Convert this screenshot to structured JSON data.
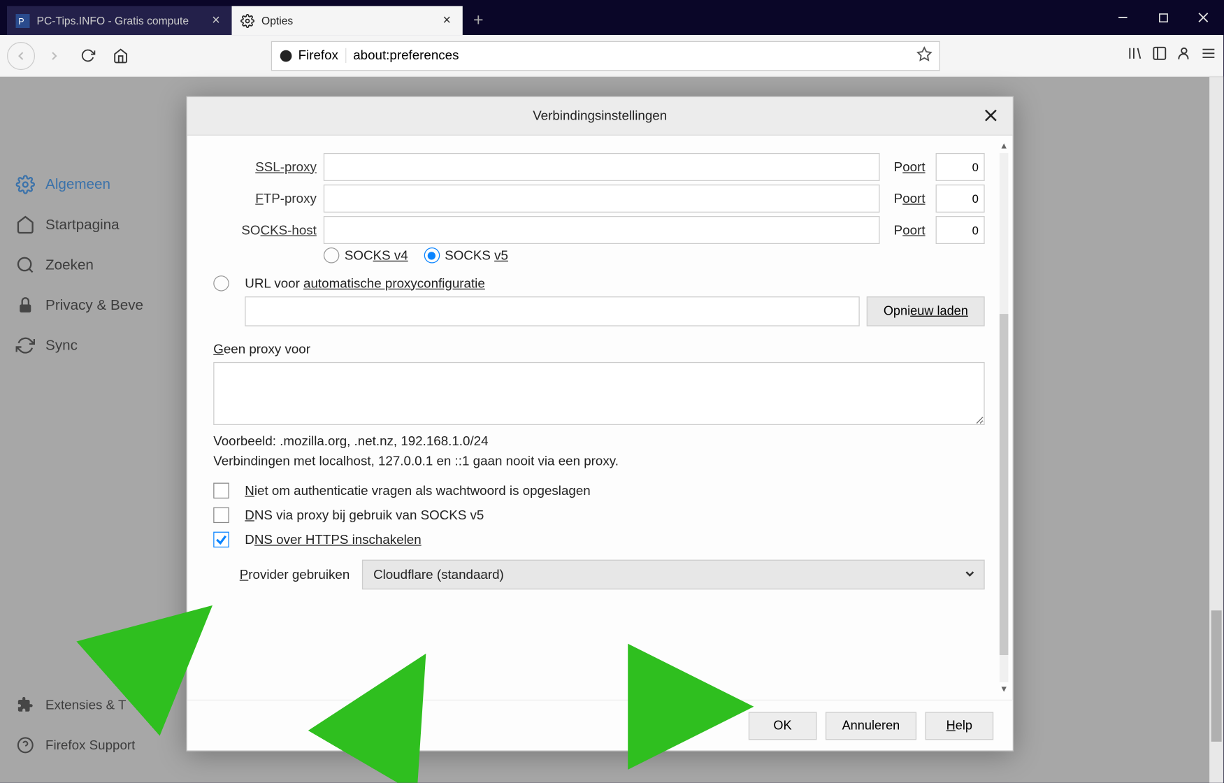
{
  "tabs": {
    "inactive": {
      "label": "PC-Tips.INFO - Gratis compute"
    },
    "active": {
      "label": "Opties"
    }
  },
  "urlbar": {
    "identity": "Firefox",
    "url": "about:preferences"
  },
  "sidebar": {
    "items": [
      {
        "label": "Algemeen"
      },
      {
        "label": "Startpagina"
      },
      {
        "label": "Zoeken"
      },
      {
        "label": "Privacy & Beve"
      },
      {
        "label": "Sync"
      }
    ],
    "bottom": [
      {
        "label": "Extensies & T"
      },
      {
        "label": "Firefox Support"
      }
    ]
  },
  "dialog": {
    "title": "Verbindingsinstellingen",
    "ssl_label": "SSL-proxy",
    "ftp_label_1": "F",
    "ftp_label_2": "TP-proxy",
    "socks_label_1": "SO",
    "socks_label_2": "CKS-host",
    "port_label_1": "P",
    "port_label_2": "oort",
    "ssl_port": "0",
    "ftp_port": "0",
    "socks_port": "0",
    "socks_v4_1": "SOC",
    "socks_v4_2": "KS v4",
    "socks_v5_1": "SOCKS ",
    "socks_v5_2": "v5",
    "url_auto_1": "URL voor ",
    "url_auto_2": "automatische proxyconfiguratie",
    "reload_1": "Opni",
    "reload_2": "euw laden",
    "noproxy_1": "G",
    "noproxy_2": "een proxy voor",
    "example": "Voorbeeld: .mozilla.org, .net.nz, 192.168.1.0/24",
    "localhost_note": "Verbindingen met localhost, 127.0.0.1 en ::1 gaan nooit via een proxy.",
    "noauth_1": "N",
    "noauth_2": "iet om authenticatie vragen als wachtwoord is opgeslagen",
    "dns_socks_1": "D",
    "dns_socks_2": "NS via proxy bij gebruik van SOCKS v5",
    "dns_https_1": "D",
    "dns_https_2": "NS over HTTPS inschakelen",
    "provider_1": "P",
    "provider_2": "rovider gebruiken",
    "provider_value": "Cloudflare (standaard)",
    "ok": "OK",
    "cancel": "Annuleren",
    "help_1": "H",
    "help_2": "elp"
  }
}
